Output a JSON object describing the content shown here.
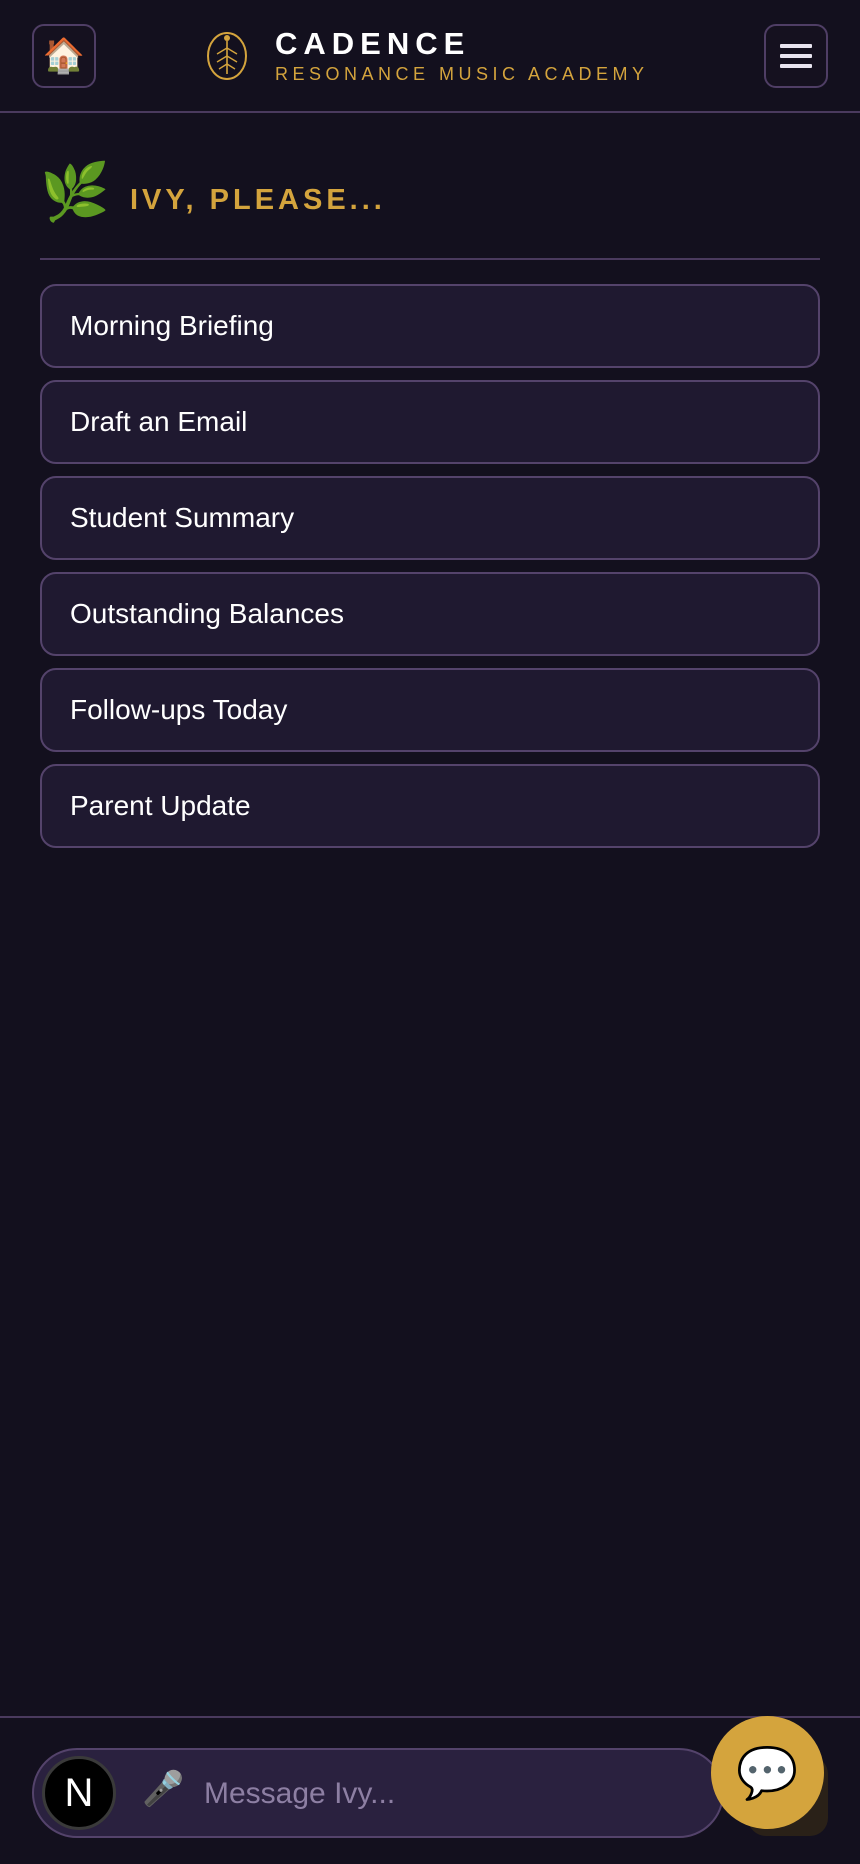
{
  "header": {
    "brand_title": "CADENCE",
    "brand_subtitle": "RESONANCE MUSIC ACADEMY",
    "home_icon": "house-icon",
    "menu_icon": "hamburger-icon"
  },
  "section": {
    "title": "IVY, PLEASE...",
    "icon": "herb-leaf-icon"
  },
  "actions": [
    {
      "label": "Morning Briefing"
    },
    {
      "label": "Draft an Email"
    },
    {
      "label": "Student Summary"
    },
    {
      "label": "Outstanding Balances"
    },
    {
      "label": "Follow-ups Today"
    },
    {
      "label": "Parent Update"
    }
  ],
  "composer": {
    "avatar_letter": "N",
    "placeholder": "Message Ivy..."
  },
  "colors": {
    "background": "#13101e",
    "accent": "#d4a43d",
    "card": "#1f1930",
    "border": "#54436b"
  }
}
